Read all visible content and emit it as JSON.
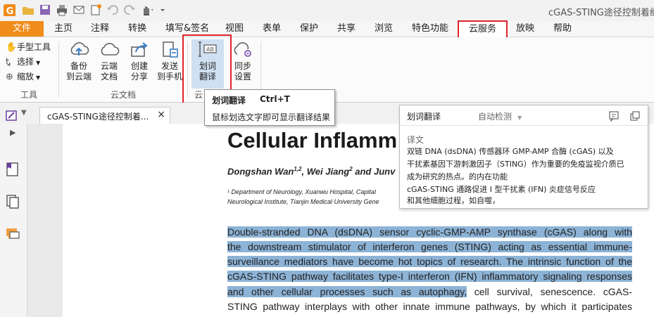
{
  "window": {
    "title": "cGAS-STING途径控制着细"
  },
  "menu": {
    "file": "文件",
    "items": [
      "主页",
      "注释",
      "转换",
      "填写&签名",
      "视图",
      "表单",
      "保护",
      "共享",
      "浏览",
      "特色功能",
      "云服务",
      "放映",
      "帮助"
    ],
    "active": "云服务"
  },
  "ribbon": {
    "tools": {
      "hand": "手型工具",
      "select": "选择",
      "zoom": "缩放",
      "group": "工具"
    },
    "cloud_doc": {
      "backup": [
        "备份",
        "到云端"
      ],
      "cloud_doc": [
        "云端",
        "文档"
      ],
      "create_share": [
        "创建",
        "分享"
      ],
      "send_phone": [
        "发送",
        "到手机"
      ],
      "translate": [
        "划词",
        "翻译"
      ],
      "sync": [
        "同步",
        "设置"
      ],
      "group": "云文档",
      "group_partial": "云"
    },
    "translate_icon_text": "AB"
  },
  "tooltip": {
    "title": "划词翻译",
    "shortcut": "Ctrl+T",
    "description": "鼠标划选文字即可显示翻译结果"
  },
  "tab": {
    "label": "cGAS-STING途径控制着...",
    "close": "×"
  },
  "document": {
    "title": "Cellular Inflamm",
    "authors": {
      "author1": "Dongshan Wan",
      "author1_sup": "1,2",
      "sep": ", ",
      "author2": "Wei Jiang",
      "author2_sup": "2",
      "tail": " and Junv"
    },
    "affiliation_lines": [
      "¹ Department of Neurology, Xuanwu Hospital, Capital",
      "Neurological Institute, Tianjin Medical University Gene"
    ],
    "body_lines": [
      {
        "hl": "Double-stranded DNA (dsDNA) sensor cyclic-GMP-AMP synthase (cGAS) along with",
        "rest": ""
      },
      {
        "hl": "the downstream stimulator of interferon genes (STING) acting as essential immune-",
        "rest": ""
      },
      {
        "hl": "surveillance mediators have become hot topics of research. The intrinsic function of the",
        "rest": ""
      },
      {
        "hl": "cGAS-STING pathway facilitates type-I interferon (IFN) inflammatory signaling responses",
        "rest": ""
      },
      {
        "hl": "and other cellular processes such as autophagy,",
        "rest": " cell survival, senescence. cGAS-"
      },
      {
        "hl": "",
        "rest": "STING pathway interplays with other innate immune pathways, by which it participates"
      }
    ]
  },
  "translate_panel": {
    "title": "划词翻译",
    "detect": "自动检测",
    "label": "译文",
    "lines": [
      "双链 DNA (dsDNA) 传感器环 GMP-AMP 合酶 (cGAS) 以及",
      "干扰素基因下游刺激因子（STING）作为重要的免疫监视介质已",
      "成为研究的热点。的内在功能",
      "cGAS-STING 通路促进 I 型干扰素 (IFN) 炎症信号反应",
      "和其他细胞过程，如自噬，"
    ]
  },
  "colors": {
    "accent": "#f08c1a",
    "highlight": "#8db3d6",
    "red_outline": "#e0232b",
    "cloud_blue": "#3a7cc0"
  }
}
